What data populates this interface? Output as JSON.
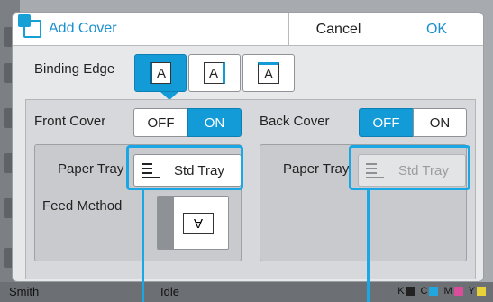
{
  "background": {
    "user": "Smith",
    "status": "Idle",
    "toner": [
      {
        "label": "K",
        "color": "#222222"
      },
      {
        "label": "C",
        "color": "#21a6dd"
      },
      {
        "label": "M",
        "color": "#d94d9a"
      },
      {
        "label": "Y",
        "color": "#e8d23a"
      }
    ]
  },
  "dialog": {
    "title": "Add Cover",
    "cancel_label": "Cancel",
    "ok_label": "OK",
    "binding_edge_label": "Binding Edge",
    "binding_options": [
      {
        "glyph": "A",
        "edge": "left",
        "selected": true
      },
      {
        "glyph": "A",
        "edge": "right",
        "selected": false
      },
      {
        "glyph": "A",
        "edge": "top",
        "selected": false
      }
    ],
    "front_cover": {
      "label": "Front Cover",
      "off_label": "OFF",
      "on_label": "ON",
      "value": "ON",
      "paper_tray_label": "Paper Tray",
      "tray_value": "Std Tray",
      "feed_method_label": "Feed Method",
      "feed_glyph": "A"
    },
    "back_cover": {
      "label": "Back Cover",
      "off_label": "OFF",
      "on_label": "ON",
      "value": "OFF",
      "paper_tray_label": "Paper Tray",
      "tray_value": "Std Tray"
    }
  },
  "colors": {
    "accent": "#139bd8",
    "callout": "#1aa7e6"
  }
}
